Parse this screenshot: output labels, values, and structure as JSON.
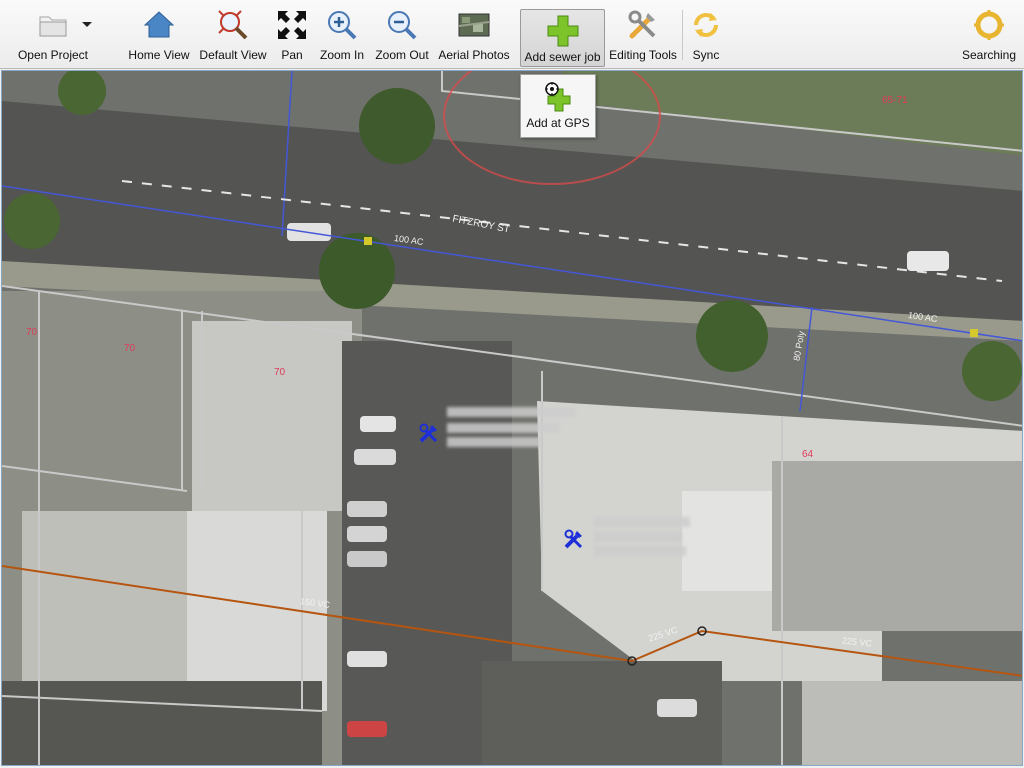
{
  "toolbar": {
    "open_project": "Open Project",
    "home_view": "Home View",
    "default_view": "Default View",
    "pan": "Pan",
    "zoom_in": "Zoom In",
    "zoom_out": "Zoom Out",
    "aerial_photos": "Aerial Photos",
    "add_sewer_job": "Add sewer job",
    "editing_tools": "Editing Tools",
    "sync": "Sync",
    "searching": "Searching"
  },
  "popup": {
    "add_at_gps": "Add at GPS"
  },
  "map": {
    "street_name": "FITZROY ST",
    "water_main_label_1": "100 AC",
    "water_main_label_2": "100 AC",
    "poly_label": "80 Poly",
    "sewer_label_1": "150 VC",
    "sewer_label_2": "225 VC",
    "sewer_label_3": "225 VC",
    "lot_70a": "70",
    "lot_70b": "70",
    "lot_70c": "70",
    "lot_64": "64",
    "lot_65_71": "65-71"
  },
  "colors": {
    "water_main": "#4457d6",
    "sewer_main": "#b5550f",
    "lot_label": "#e03a5a",
    "job_marker": "#1d2fd8",
    "highlight_circle": "#d84b4b"
  }
}
